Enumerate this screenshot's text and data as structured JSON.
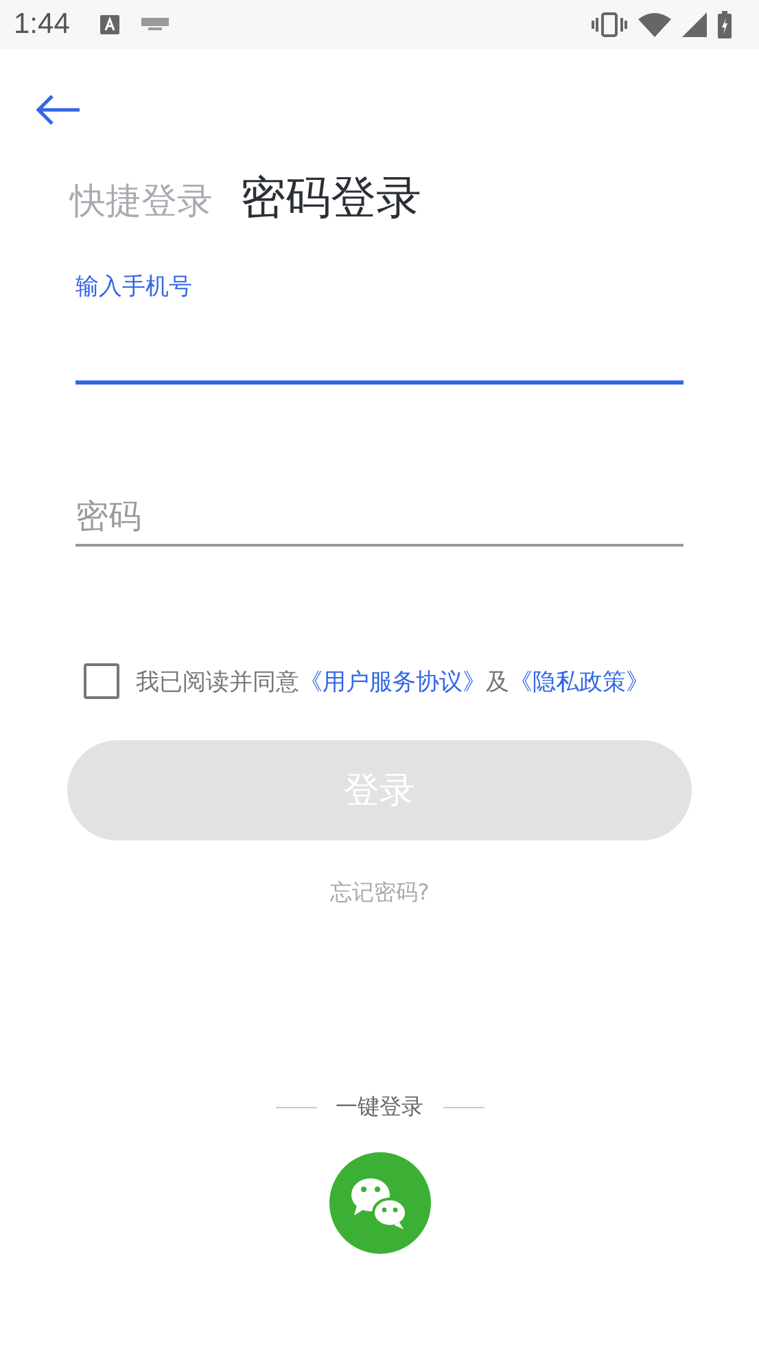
{
  "status_bar": {
    "time": "1:44"
  },
  "tabs": [
    {
      "label": "快捷登录",
      "selected": false
    },
    {
      "label": "密码登录",
      "selected": true
    }
  ],
  "phone_field": {
    "label": "输入手机号",
    "focused": true
  },
  "password_field": {
    "placeholder": "密码",
    "focused": false
  },
  "agreement": {
    "checked": false,
    "text": "我已阅读并同意",
    "link_terms": "《用户服务协议》",
    "conjunction": "及",
    "link_privacy": "《隐私政策》"
  },
  "login_button": {
    "label": "登录",
    "disabled": true
  },
  "forgot_password": "忘记密码?",
  "one_tap_login": {
    "label": "一键登录"
  }
}
